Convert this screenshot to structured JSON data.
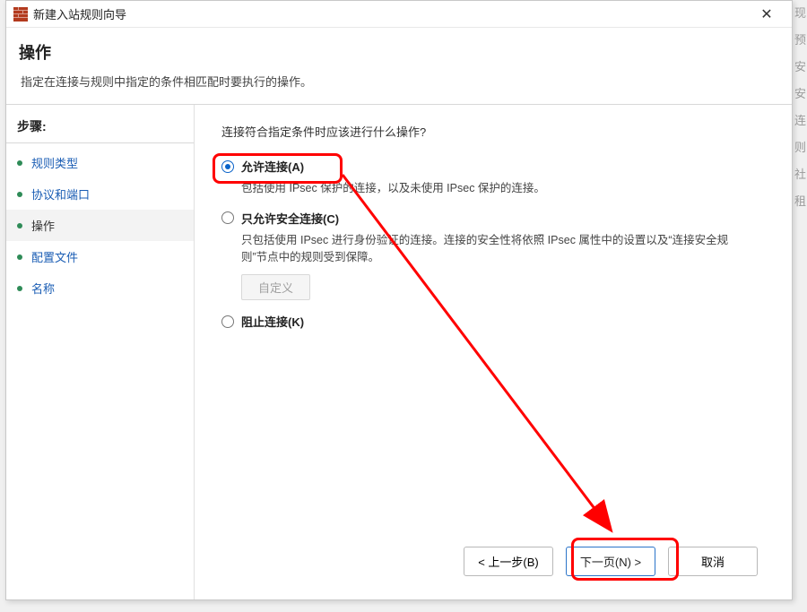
{
  "window": {
    "title": "新建入站规则向导",
    "close_glyph": "✕"
  },
  "header": {
    "title": "操作",
    "subtitle": "指定在连接与规则中指定的条件相匹配时要执行的操作。"
  },
  "steps": {
    "heading": "步骤:",
    "items": [
      {
        "label": "规则类型",
        "active": false,
        "link": true
      },
      {
        "label": "协议和端口",
        "active": false,
        "link": true
      },
      {
        "label": "操作",
        "active": true,
        "link": false
      },
      {
        "label": "配置文件",
        "active": false,
        "link": true
      },
      {
        "label": "名称",
        "active": false,
        "link": true
      }
    ]
  },
  "content": {
    "question": "连接符合指定条件时应该进行什么操作?",
    "options": [
      {
        "id": "allow",
        "label": "允许连接(A)",
        "desc": "包括使用 IPsec 保护的连接，以及未使用 IPsec 保护的连接。",
        "selected": true,
        "has_customize": false
      },
      {
        "id": "allow-secure",
        "label": "只允许安全连接(C)",
        "desc": "只包括使用 IPsec 进行身份验证的连接。连接的安全性将依照 IPsec 属性中的设置以及“连接安全规则”节点中的规则受到保障。",
        "selected": false,
        "has_customize": true
      },
      {
        "id": "block",
        "label": "阻止连接(K)",
        "desc": "",
        "selected": false,
        "has_customize": false
      }
    ],
    "customize_label": "自定义"
  },
  "footer": {
    "back": "<  上一步(B)",
    "next": "下一页(N)  >",
    "cancel": "取消"
  },
  "bg_hint_chars": [
    "现",
    "预",
    "安",
    "安",
    "连",
    "则",
    "社",
    "租"
  ]
}
